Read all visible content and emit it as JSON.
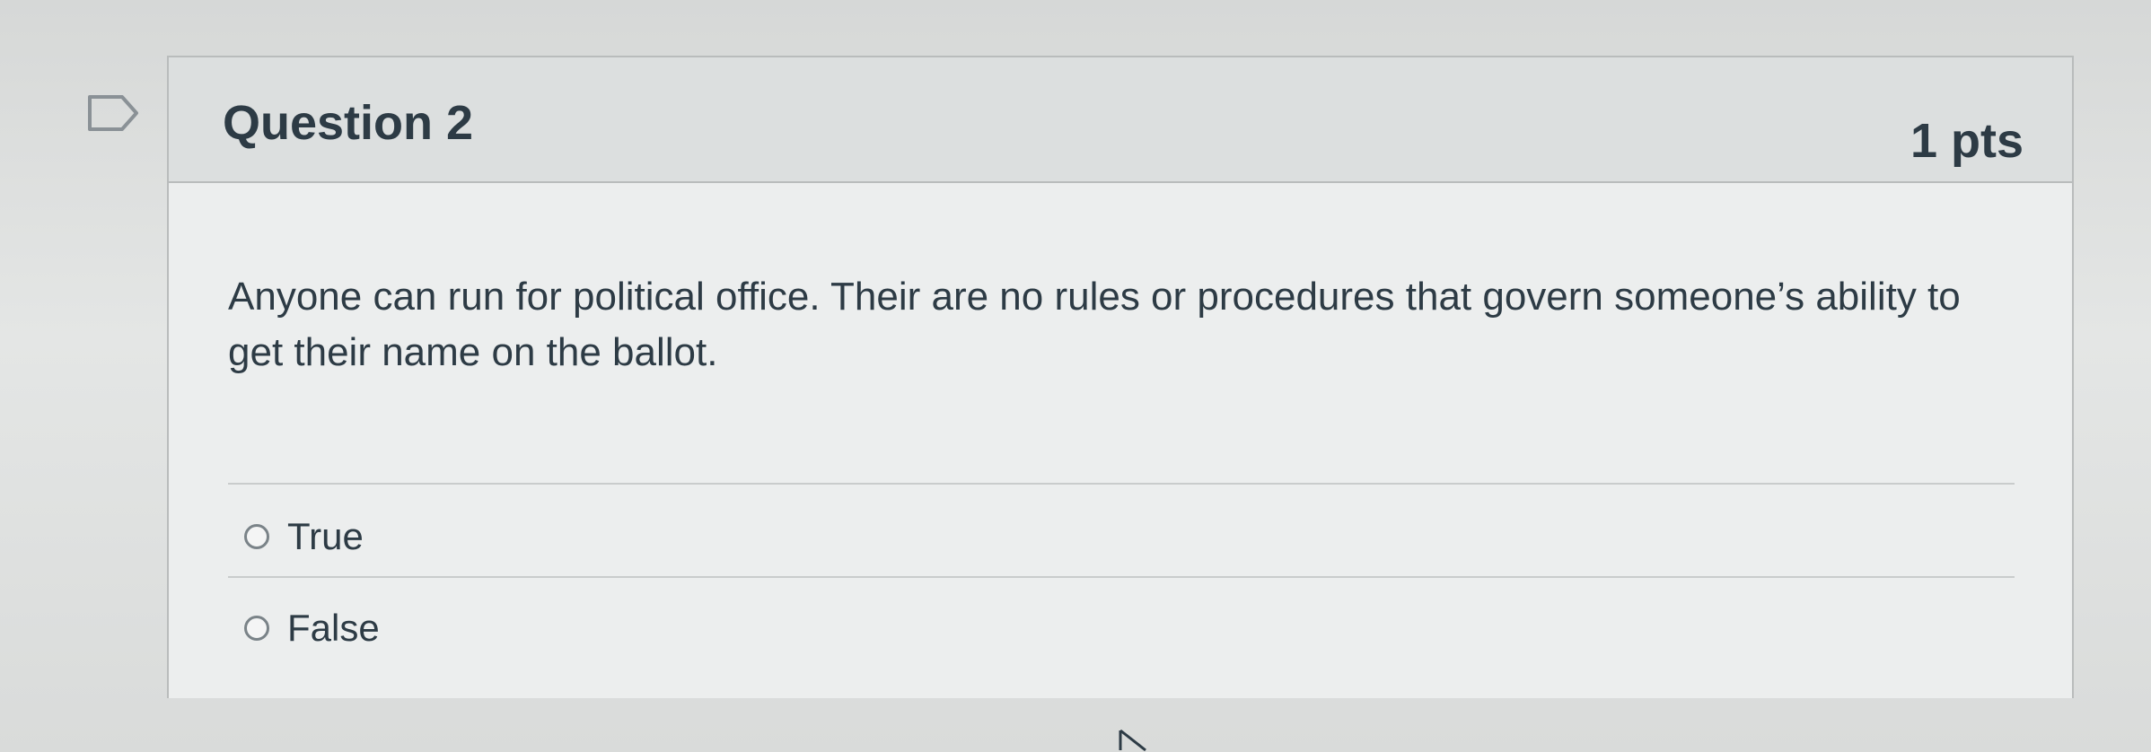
{
  "question": {
    "title": "Question 2",
    "points": "1 pts",
    "text": "Anyone can run for political office. Their  are no rules or procedures that govern someone’s ability to get their name on the ballot.",
    "answers": [
      {
        "label": "True",
        "selected": false
      },
      {
        "label": "False",
        "selected": false
      }
    ]
  },
  "icons": {
    "flag": "flag-bookmark-icon",
    "cursor": "mouse-pointer-icon"
  },
  "colors": {
    "text": "#2d3b45",
    "border": "#b9bcbc"
  }
}
